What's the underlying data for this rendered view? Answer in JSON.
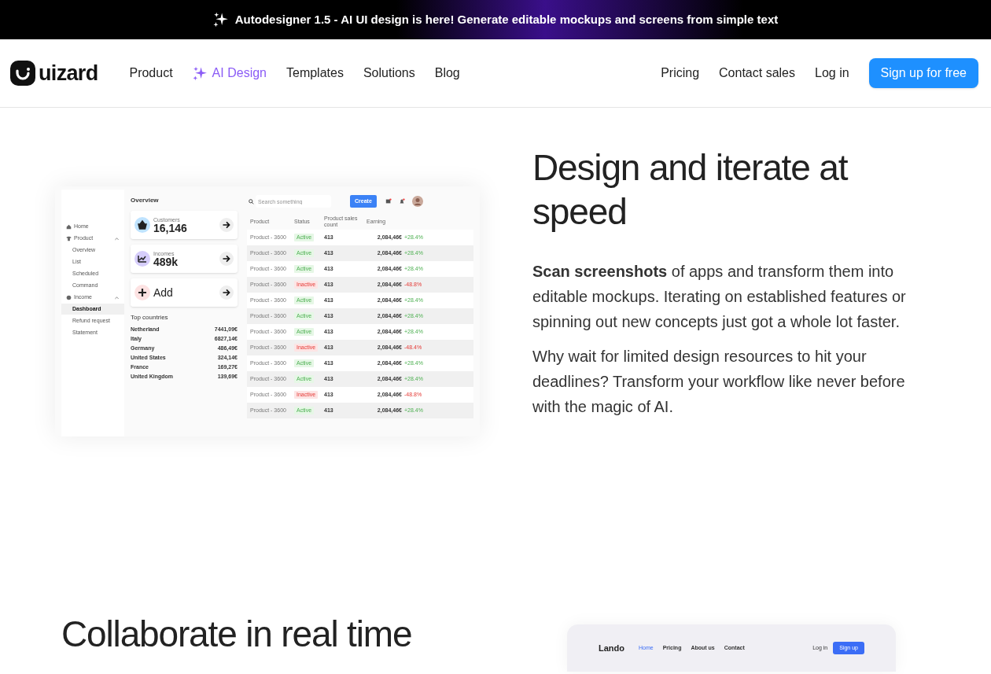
{
  "banner": {
    "text": "Autodesigner 1.5 - AI UI design is here! Generate editable mockups and screens from simple text"
  },
  "nav": {
    "logo": "uizard",
    "links": [
      {
        "label": "Product",
        "kind": "plain"
      },
      {
        "label": "AI Design",
        "kind": "ai"
      },
      {
        "label": "Templates",
        "kind": "plain"
      },
      {
        "label": "Solutions",
        "kind": "plain"
      },
      {
        "label": "Blog",
        "kind": "plain"
      }
    ],
    "right_links": [
      "Pricing",
      "Contact sales",
      "Log in"
    ],
    "cta": "Sign up for free"
  },
  "hero": {
    "title": "Design and iterate at speed",
    "paragraphs": [
      "**Scan screenshots** of apps and transform them into editable mockups. Iterating on established features or spinning out new concepts just got a whole lot faster.",
      "Why wait for limited design resources to hit your deadlines? Transform your workflow like never before with the magic of AI."
    ]
  },
  "dashboard": {
    "sidebar": [
      {
        "label": "Home"
      },
      {
        "label": "Product",
        "expanded": true,
        "children": [
          {
            "label": "Overview",
            "selected": false
          },
          {
            "label": "List",
            "selected": false
          },
          {
            "label": "Scheduled",
            "selected": false
          },
          {
            "label": "Command",
            "selected": false
          }
        ]
      },
      {
        "label": "Income",
        "expanded": true,
        "children": [
          {
            "label": "Dashboard",
            "selected": true
          },
          {
            "label": "Refund request",
            "selected": false
          },
          {
            "label": "Statement",
            "selected": false
          }
        ]
      }
    ],
    "overview_title": "Overview",
    "cards": [
      {
        "kind": "stat",
        "label": "Customers",
        "value": "16,146"
      },
      {
        "kind": "stat",
        "label": "Incomes",
        "value": "489k"
      },
      {
        "kind": "add",
        "value": "Add"
      }
    ],
    "countries_title": "Top countries",
    "countries": [
      {
        "name": "Netherland",
        "value": "7441,09€"
      },
      {
        "name": "Italy",
        "value": "6827,14€"
      },
      {
        "name": "Germany",
        "value": "486,49€"
      },
      {
        "name": "United States",
        "value": "324,14€"
      },
      {
        "name": "France",
        "value": "169,27€"
      },
      {
        "name": "United Kingdom",
        "value": "139,69€"
      }
    ],
    "search_placeholder": "Search something",
    "create": "Create",
    "columns": [
      "Product",
      "Status",
      "Product sales count",
      "Earning"
    ],
    "rows": [
      {
        "product": "Product - 3600",
        "status": "Active",
        "kind": "active",
        "sales": "413",
        "earning": "2,084,46€",
        "change": "+28.4%"
      },
      {
        "product": "Product - 3600",
        "status": "Active",
        "kind": "active",
        "sales": "413",
        "earning": "2,084,46€",
        "change": "+28.4%"
      },
      {
        "product": "Product - 3600",
        "status": "Active",
        "kind": "active",
        "sales": "413",
        "earning": "2,084,46€",
        "change": "+28.4%"
      },
      {
        "product": "Product - 3600",
        "status": "Inactive",
        "kind": "inactive",
        "sales": "413",
        "earning": "2,084,46€",
        "change": "-48.8%"
      },
      {
        "product": "Product - 3600",
        "status": "Active",
        "kind": "active",
        "sales": "413",
        "earning": "2,084,46€",
        "change": "+28.4%"
      },
      {
        "product": "Product - 3600",
        "status": "Active",
        "kind": "active",
        "sales": "413",
        "earning": "2,084,46€",
        "change": "+28.4%"
      },
      {
        "product": "Product - 3600",
        "status": "Active",
        "kind": "active",
        "sales": "413",
        "earning": "2,084,46€",
        "change": "+28.4%"
      },
      {
        "product": "Product - 3600",
        "status": "Inactive",
        "kind": "inactive",
        "sales": "413",
        "earning": "2,084,46€",
        "change": "-48.4%"
      },
      {
        "product": "Product - 3600",
        "status": "Active",
        "kind": "active",
        "sales": "413",
        "earning": "2,084,46€",
        "change": "+28.4%"
      },
      {
        "product": "Product - 3600",
        "status": "Active",
        "kind": "active",
        "sales": "413",
        "earning": "2,084,46€",
        "change": "+28.4%"
      },
      {
        "product": "Product - 3600",
        "status": "Inactive",
        "kind": "inactive",
        "sales": "413",
        "earning": "2,084,46€",
        "change": "-48.8%"
      },
      {
        "product": "Product - 3600",
        "status": "Active",
        "kind": "active",
        "sales": "413",
        "earning": "2,084,46€",
        "change": "+28.4%"
      }
    ]
  },
  "collab": {
    "title": "Collaborate in real time",
    "site": {
      "logo": "Lando",
      "links": [
        {
          "label": "Home",
          "selected": true
        },
        {
          "label": "Pricing",
          "selected": false
        },
        {
          "label": "About us",
          "selected": false
        },
        {
          "label": "Contact",
          "selected": false
        }
      ],
      "login": "Log in",
      "signup": "Sign up"
    }
  }
}
